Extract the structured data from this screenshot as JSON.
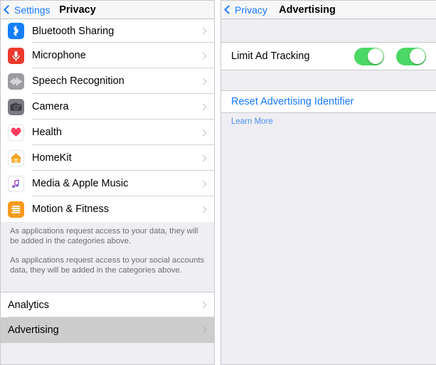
{
  "left_panel": {
    "navbar": {
      "back_label": "Settings",
      "back_icon": "chevron-left-icon",
      "title": "Privacy"
    },
    "rows": [
      {
        "label": "Bluetooth Sharing",
        "icon": "bluetooth-icon",
        "accessory": "chevron-right-icon",
        "selected": false
      },
      {
        "label": "Microphone",
        "icon": "microphone-icon",
        "accessory": "chevron-right-icon",
        "selected": false
      },
      {
        "label": "Speech Recognition",
        "icon": "waveform-icon",
        "accessory": "chevron-right-icon",
        "selected": false
      },
      {
        "label": "Camera",
        "icon": "camera-icon",
        "accessory": "chevron-right-icon",
        "selected": false
      },
      {
        "label": "Health",
        "icon": "heart-icon",
        "accessory": "chevron-right-icon",
        "selected": false
      },
      {
        "label": "HomeKit",
        "icon": "house-icon",
        "accessory": "chevron-right-icon",
        "selected": false
      },
      {
        "label": "Media & Apple Music",
        "icon": "music-note-icon",
        "accessory": "chevron-right-icon",
        "selected": false
      },
      {
        "label": "Motion & Fitness",
        "icon": "motion-icon",
        "accessory": "chevron-right-icon",
        "selected": false
      }
    ],
    "footer": {
      "paragraph_1": "As applications request access to your data, they will be added in the categories above.",
      "paragraph_2": "As applications request access to your social accounts data, they will be added in the categories above."
    },
    "bottom_rows": [
      {
        "label": "Analytics",
        "accessory": "chevron-right-icon",
        "selected": false
      },
      {
        "label": "Advertising",
        "accessory": "chevron-right-icon",
        "selected": true
      }
    ]
  },
  "right_panel": {
    "navbar": {
      "back_label": "Privacy",
      "back_icon": "chevron-left-icon",
      "title": "Advertising"
    },
    "switch_row": {
      "label": "Limit Ad Tracking",
      "switches": [
        {
          "name": "limit-ad-tracking-toggle-1",
          "state": "on"
        },
        {
          "name": "limit-ad-tracking-toggle-2",
          "state": "on"
        }
      ]
    },
    "reset_link": "Reset Advertising Identifier",
    "learn_more_link": "Learn More"
  },
  "colors": {
    "tint_blue": "#1879ff",
    "switch_green": "#4cd864",
    "group_bg": "#eeeef3",
    "cell_bg": "#ffffff",
    "selected_bg": "#cdcdcd",
    "footer_text": "#6d6d72",
    "separator": "#d3d3d7"
  }
}
